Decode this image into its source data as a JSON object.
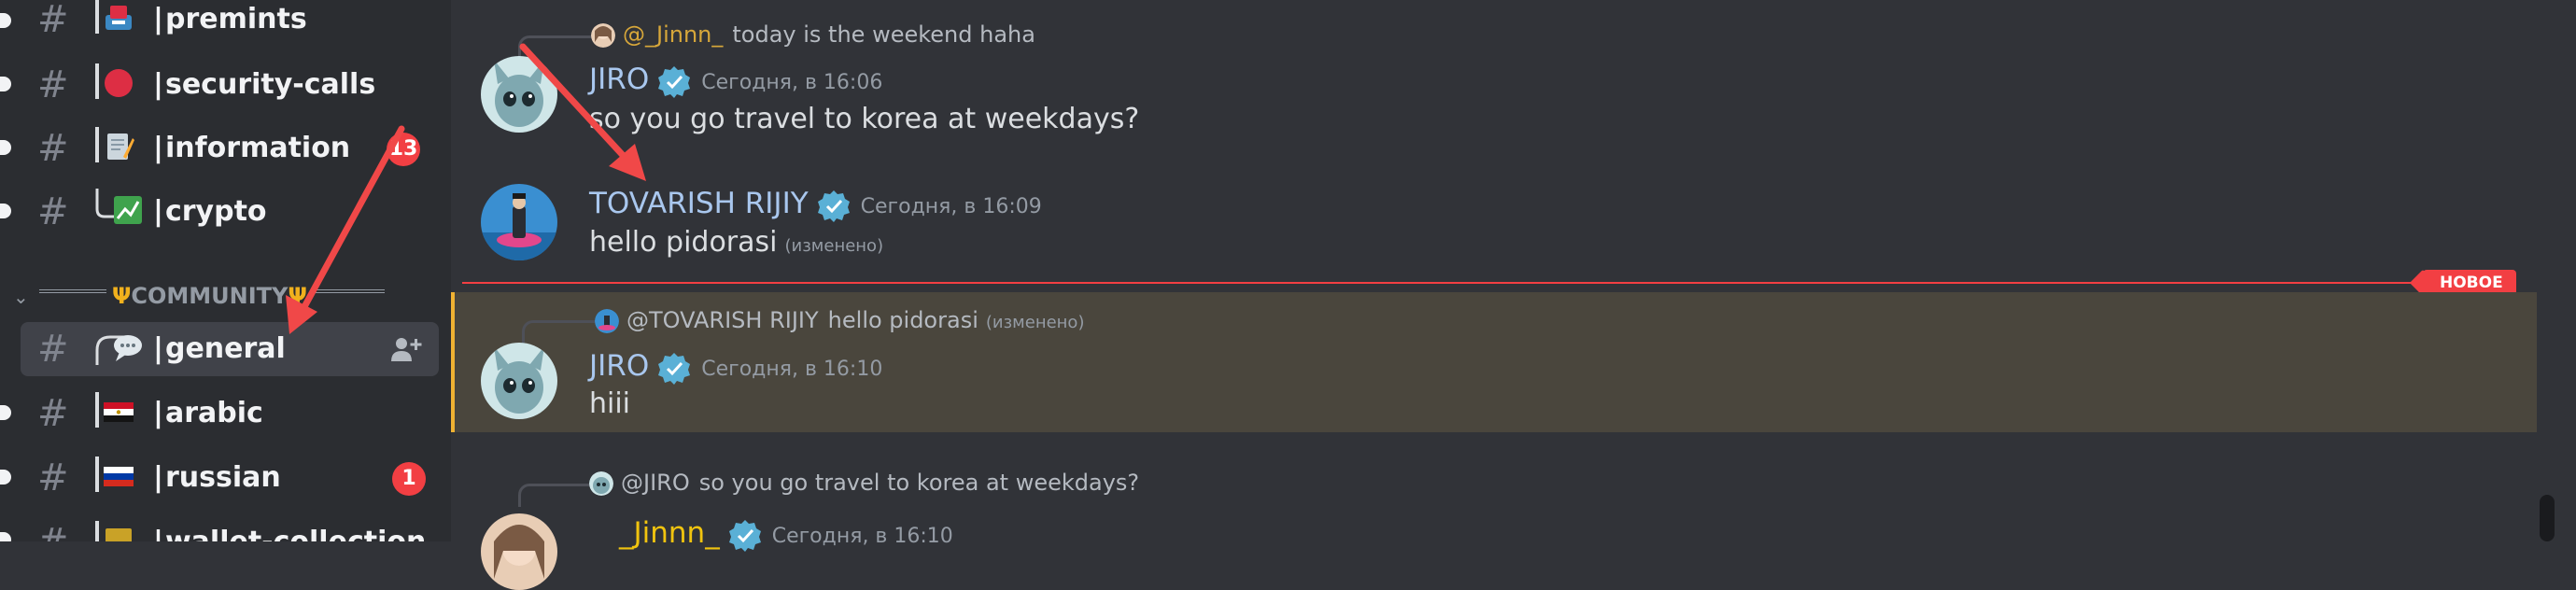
{
  "sidebar": {
    "channels": [
      {
        "hash": "#",
        "icon": "inbox-tray-emoji",
        "prefix": "|",
        "name": "premints",
        "unread": true,
        "badge": ""
      },
      {
        "hash": "#",
        "icon": "red-circle-emoji",
        "prefix": "|",
        "name": "security-calls",
        "unread": true,
        "badge": ""
      },
      {
        "hash": "#",
        "icon": "memo-emoji",
        "prefix": "|",
        "name": "information",
        "unread": true,
        "badge": "13"
      },
      {
        "hash": "#",
        "icon": "chart-emoji",
        "prefix": "|",
        "name": "crypto",
        "unread": true,
        "badge": ""
      }
    ],
    "category": {
      "label": "COMMUNITY",
      "icon": "trident-emoji"
    },
    "channels2": [
      {
        "hash": "#",
        "icon": "speech-bubble-emoji",
        "prefix": "|",
        "name": "general",
        "selected": true
      },
      {
        "hash": "#",
        "icon": "flag-egypt-emoji",
        "prefix": "|",
        "name": "arabic",
        "unread": true,
        "badge": ""
      },
      {
        "hash": "#",
        "icon": "flag-russia-emoji",
        "prefix": "|",
        "name": "russian",
        "unread": true,
        "badge": "1"
      },
      {
        "hash": "#",
        "icon": "ledger-emoji",
        "prefix": "|",
        "name": "wallet-collection",
        "unread": true,
        "badge": ""
      }
    ],
    "create_invite_icon": "add-member-icon"
  },
  "messages": [
    {
      "reply": {
        "author": "@_Jinnn_",
        "text": "today is the weekend haha",
        "edited": ""
      },
      "author": "JIRO",
      "timestamp": "Сегодня, в 16:06",
      "content": "so you go travel to korea at weekdays?",
      "edited": ""
    },
    {
      "author": "TOVARISH RIJIY",
      "timestamp": "Сегодня, в 16:09",
      "content": "hello pidorasi",
      "edited": "(изменено)"
    },
    {
      "reply": {
        "author": "@TOVARISH RIJIY",
        "text": "hello pidorasi",
        "edited": "(изменено)"
      },
      "author": "JIRO",
      "timestamp": "Сегодня, в 16:10",
      "content": "hiii",
      "edited": ""
    },
    {
      "reply": {
        "author": "@JIRO",
        "text": "so you go travel to korea at weekdays?",
        "edited": ""
      },
      "author": "_Jinnn_",
      "timestamp": "Сегодня, в 16:10",
      "content": "",
      "edited": ""
    }
  ],
  "new_divider_label": "НОВОЕ",
  "colors": {
    "sidebar_bg": "#2b2d31",
    "chat_bg": "#313338",
    "mention_highlight": "#4a463d",
    "mention_bar": "#f0b232",
    "badge_red": "#f23f43",
    "annotation_arrow": "#f04848",
    "verified": "#5ab0d6"
  }
}
